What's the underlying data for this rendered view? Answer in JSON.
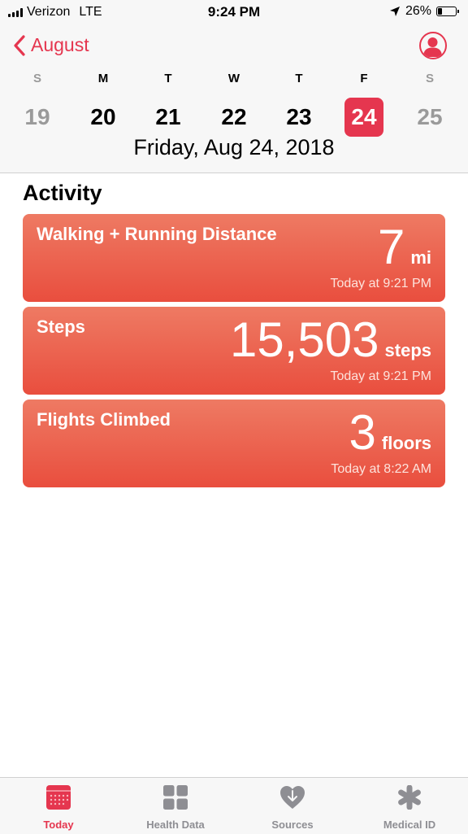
{
  "status_bar": {
    "carrier": "Verizon",
    "network": "LTE",
    "time": "9:24 PM",
    "battery_percent": "26%",
    "battery_level": 0.26
  },
  "header": {
    "back_label": "August",
    "weekdays": [
      "S",
      "M",
      "T",
      "W",
      "T",
      "F",
      "S"
    ],
    "dates": [
      "19",
      "20",
      "21",
      "22",
      "23",
      "24",
      "25"
    ],
    "selected_index": 5,
    "full_date": "Friday, Aug 24, 2018"
  },
  "section_title": "Activity",
  "cards": [
    {
      "title": "Walking + Running Distance",
      "value": "7",
      "unit": "mi",
      "time": "Today at 9:21 PM"
    },
    {
      "title": "Steps",
      "value": "15,503",
      "unit": "steps",
      "time": "Today at 9:21 PM"
    },
    {
      "title": "Flights Climbed",
      "value": "3",
      "unit": "floors",
      "time": "Today at 8:22 AM"
    }
  ],
  "tabs": [
    {
      "label": "Today",
      "icon": "calendar-icon",
      "active": true
    },
    {
      "label": "Health Data",
      "icon": "grid-icon",
      "active": false
    },
    {
      "label": "Sources",
      "icon": "heart-download-icon",
      "active": false
    },
    {
      "label": "Medical ID",
      "icon": "asterisk-icon",
      "active": false
    }
  ],
  "colors": {
    "accent": "#e5364f",
    "card_top": "#ee7a63",
    "card_bottom": "#e94e3e",
    "tab_inactive": "#8e8e93"
  }
}
